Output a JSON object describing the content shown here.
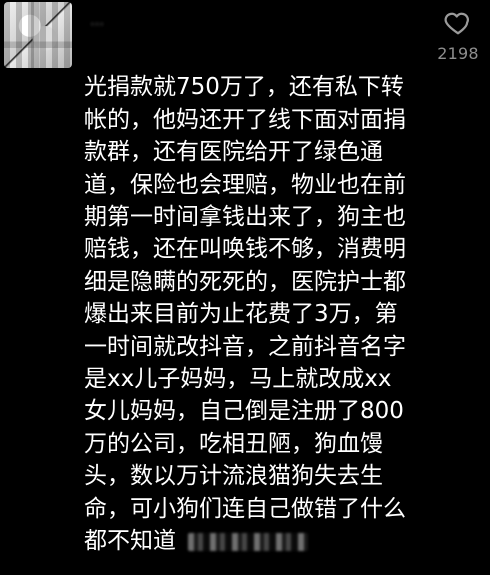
{
  "comment": {
    "author": "…",
    "text": "光捐款就750万了，还有私下转\n帐的，他妈还开了线下面对面捐\n款群，还有医院给开了绿色通\n道，保险也会理赔，物业也在前\n期第一时间拿钱出来了，狗主也\n赔钱，还在叫唤钱不够，消费明\n细是隐瞒的死死的，医院护士都\n爆出来目前为止花费了3万，第\n一时间就改抖音，之前抖音名字\n是xx儿子妈妈，马上就改成xx\n女儿妈妈，自己倒是注册了800\n万的公司，吃相丑陋，狗血馒\n头，数以万计流浪猫狗失去生\n命，可小狗们连自己做错了什么\n都不知道",
    "like_count": "2198",
    "redacted_tail": "…"
  },
  "icons": {
    "like": "heart-outline-icon",
    "avatar": "user-avatar"
  },
  "colors": {
    "background": "#000000",
    "text": "#ffffff",
    "secondary": "#8e8e8e"
  }
}
